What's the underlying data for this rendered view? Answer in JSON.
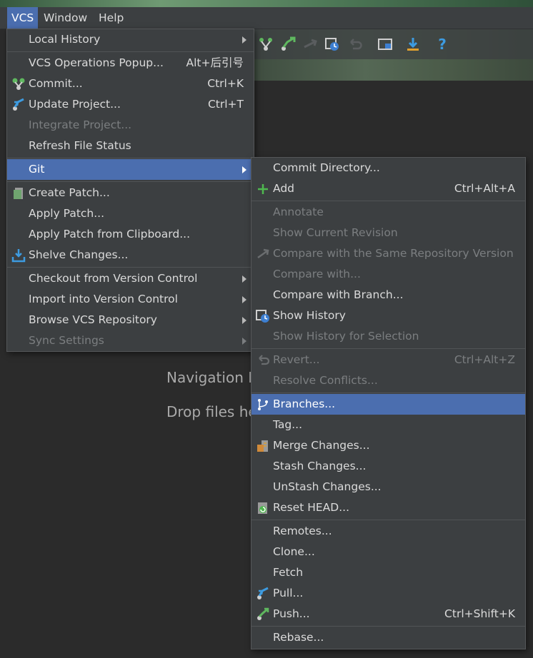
{
  "menubar": {
    "items": [
      {
        "label": "VCS",
        "active": true
      },
      {
        "label": "Window",
        "active": false
      },
      {
        "label": "Help",
        "active": false
      }
    ]
  },
  "toolbar": {
    "icons": [
      "commit-icon",
      "update-project-icon",
      "compare-icon",
      "show-history-icon",
      "revert-icon",
      "project-structure-icon",
      "download-icon",
      "help-icon"
    ]
  },
  "background": {
    "hint1": "Navigation E",
    "hint2": "Drop files he"
  },
  "vcs_menu": {
    "items": [
      {
        "label": "Local History",
        "shortcut": "",
        "submenu": true
      },
      {
        "label": "VCS Operations Popup...",
        "shortcut": "Alt+后引号",
        "submenu": false
      },
      {
        "label": "Commit...",
        "shortcut": "Ctrl+K",
        "icon": "commit-icon"
      },
      {
        "label": "Update Project...",
        "shortcut": "Ctrl+T",
        "icon": "update-project-icon"
      },
      {
        "label": "Integrate Project...",
        "shortcut": "",
        "disabled": true
      },
      {
        "label": "Refresh File Status",
        "shortcut": ""
      },
      {
        "label": "Git",
        "shortcut": "",
        "submenu": true,
        "highlighted": true
      },
      {
        "label": "Create Patch...",
        "shortcut": "",
        "icon": "create-patch-icon"
      },
      {
        "label": "Apply Patch...",
        "shortcut": ""
      },
      {
        "label": "Apply Patch from Clipboard...",
        "shortcut": ""
      },
      {
        "label": "Shelve Changes...",
        "shortcut": "",
        "icon": "shelve-icon"
      },
      {
        "label": "Checkout from Version Control",
        "shortcut": "",
        "submenu": true
      },
      {
        "label": "Import into Version Control",
        "shortcut": "",
        "submenu": true
      },
      {
        "label": "Browse VCS Repository",
        "shortcut": "",
        "submenu": true
      },
      {
        "label": "Sync Settings",
        "shortcut": "",
        "submenu": true,
        "disabled": true
      }
    ]
  },
  "git_menu": {
    "items": [
      {
        "label": "Commit Directory...",
        "shortcut": ""
      },
      {
        "label": "Add",
        "shortcut": "Ctrl+Alt+A",
        "icon": "add-icon"
      },
      {
        "label": "Annotate",
        "shortcut": "",
        "disabled": true
      },
      {
        "label": "Show Current Revision",
        "shortcut": "",
        "disabled": true
      },
      {
        "label": "Compare with the Same Repository Version",
        "shortcut": "",
        "disabled": true,
        "icon": "compare-icon"
      },
      {
        "label": "Compare with...",
        "shortcut": "",
        "disabled": true
      },
      {
        "label": "Compare with Branch...",
        "shortcut": ""
      },
      {
        "label": "Show History",
        "shortcut": "",
        "icon": "show-history-icon"
      },
      {
        "label": "Show History for Selection",
        "shortcut": "",
        "disabled": true
      },
      {
        "label": "Revert...",
        "shortcut": "Ctrl+Alt+Z",
        "disabled": true,
        "icon": "revert-icon"
      },
      {
        "label": "Resolve Conflicts...",
        "shortcut": "",
        "disabled": true
      },
      {
        "label": "Branches...",
        "shortcut": "",
        "highlighted": true,
        "icon": "branches-icon"
      },
      {
        "label": "Tag...",
        "shortcut": ""
      },
      {
        "label": "Merge Changes...",
        "shortcut": "",
        "icon": "merge-icon"
      },
      {
        "label": "Stash Changes...",
        "shortcut": ""
      },
      {
        "label": "UnStash Changes...",
        "shortcut": ""
      },
      {
        "label": "Reset HEAD...",
        "shortcut": "",
        "icon": "reset-head-icon"
      },
      {
        "label": "Remotes...",
        "shortcut": ""
      },
      {
        "label": "Clone...",
        "shortcut": ""
      },
      {
        "label": "Fetch",
        "shortcut": ""
      },
      {
        "label": "Pull...",
        "shortcut": "",
        "icon": "pull-icon"
      },
      {
        "label": "Push...",
        "shortcut": "Ctrl+Shift+K",
        "icon": "push-icon"
      },
      {
        "label": "Rebase...",
        "shortcut": ""
      }
    ]
  }
}
